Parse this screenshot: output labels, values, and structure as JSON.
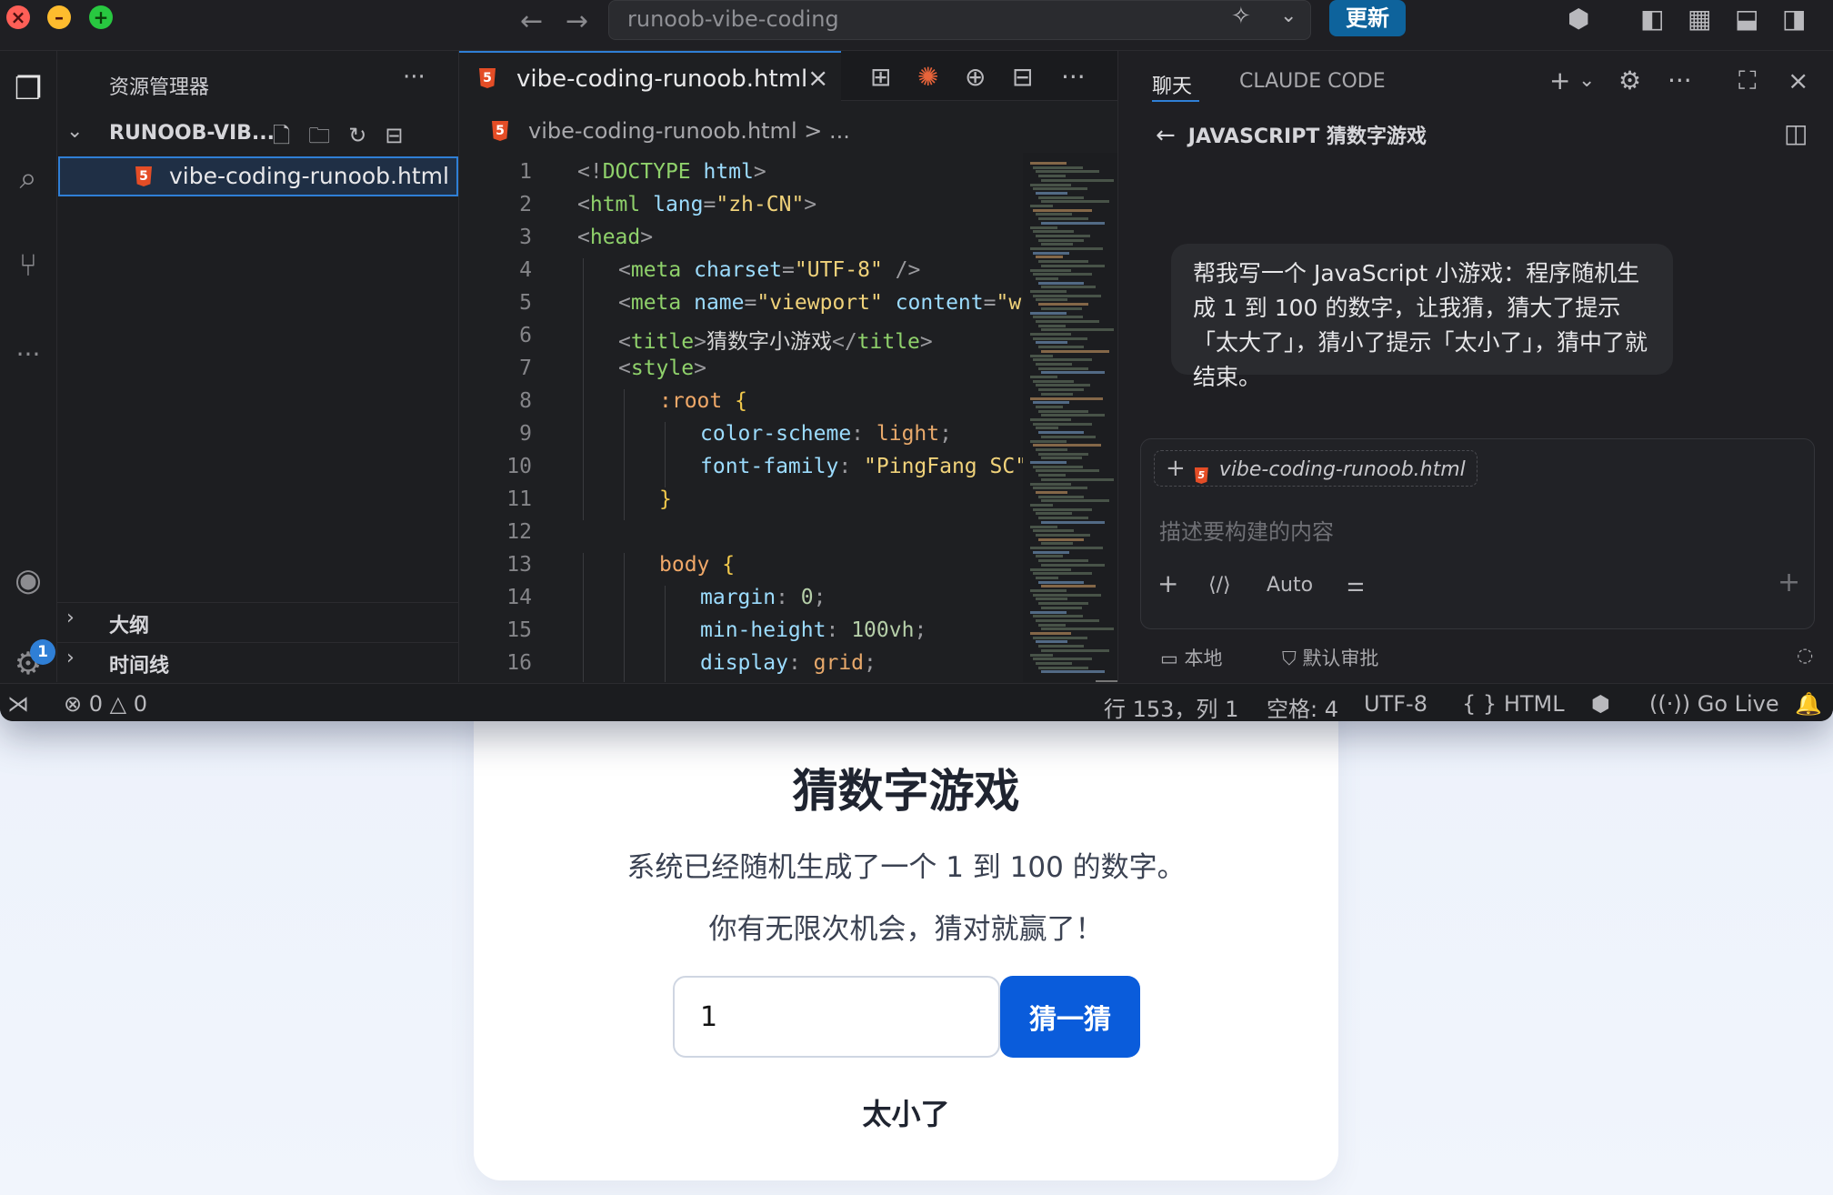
{
  "window": {
    "search_text": "runoob-vibe-coding",
    "update_label": "更新"
  },
  "explorer": {
    "title": "资源管理器",
    "folder_name": "RUNOOB-VIB...",
    "file_name": "vibe-coding-runoob.html",
    "outline_label": "大纲",
    "timeline_label": "时间线"
  },
  "activity": {
    "settings_badge": "1"
  },
  "editor": {
    "tab_name": "vibe-coding-runoob.html",
    "breadcrumb": "vibe-coding-runoob.html > ...",
    "lines": [
      {
        "n": "1",
        "indent": 0
      },
      {
        "n": "2",
        "indent": 0
      },
      {
        "n": "3",
        "indent": 0
      },
      {
        "n": "4",
        "indent": 1
      },
      {
        "n": "5",
        "indent": 1
      },
      {
        "n": "6",
        "indent": 1
      },
      {
        "n": "7",
        "indent": 1
      },
      {
        "n": "8",
        "indent": 2
      },
      {
        "n": "9",
        "indent": 3
      },
      {
        "n": "10",
        "indent": 3
      },
      {
        "n": "11",
        "indent": 2
      },
      {
        "n": "12",
        "indent": 0
      },
      {
        "n": "13",
        "indent": 2
      },
      {
        "n": "14",
        "indent": 3
      },
      {
        "n": "15",
        "indent": 3
      },
      {
        "n": "16",
        "indent": 3
      }
    ],
    "code": {
      "l1": [
        "<!",
        "DOCTYPE",
        " html",
        ">"
      ],
      "l2": [
        "<",
        "html",
        " lang",
        "=",
        "\"zh-CN\"",
        ">"
      ],
      "l3": [
        "<",
        "head",
        ">"
      ],
      "l4": [
        "<",
        "meta",
        " charset",
        "=",
        "\"UTF-8\"",
        " />"
      ],
      "l5": [
        "<",
        "meta",
        " name",
        "=",
        "\"viewport\"",
        " content",
        "=",
        "\"w"
      ],
      "l6": [
        "<",
        "title",
        ">",
        "猜数字小游戏",
        "</",
        "title",
        ">"
      ],
      "l7": [
        "<",
        "style",
        ">"
      ],
      "l8": [
        ":root",
        " {"
      ],
      "l9": [
        "color-scheme",
        ": ",
        "light",
        ";"
      ],
      "l10": [
        "font-family",
        ": ",
        "\"PingFang SC\"",
        ","
      ],
      "l11": [
        "}"
      ],
      "l12": [],
      "l13": [
        "body",
        " {"
      ],
      "l14": [
        "margin",
        ": ",
        "0",
        ";"
      ],
      "l15": [
        "min-height",
        ": ",
        "100vh",
        ";"
      ],
      "l16": [
        "display",
        ": ",
        "grid",
        ";"
      ]
    }
  },
  "chat": {
    "tab_chat": "聊天",
    "tab_claude": "CLAUDE CODE",
    "header": "JAVASCRIPT 猜数字游戏",
    "message": "帮我写一个 JavaScript 小游戏：程序随机生成 1 到 100 的数字，让我猜，猜大了提示「太大了」，猜小了提示「太小了」，猜中了就结束。",
    "context_file": "vibe-coding-runoob.html",
    "placeholder": "描述要构建的内容",
    "mode": "Auto",
    "footer_local": "本地",
    "footer_approval": "默认审批"
  },
  "statusbar": {
    "errors": "0",
    "warnings": "0",
    "cursor": "行 153，列 1",
    "spaces": "空格: 4",
    "encoding": "UTF-8",
    "language": "HTML",
    "go_live": "Go Live"
  },
  "game": {
    "title": "猜数字游戏",
    "desc1": "系统已经随机生成了一个 1 到 100 的数字。",
    "desc2": "你有无限次机会，猜对就赢了！",
    "input_value": "1",
    "button_label": "猜一猜",
    "result": "太小了"
  }
}
